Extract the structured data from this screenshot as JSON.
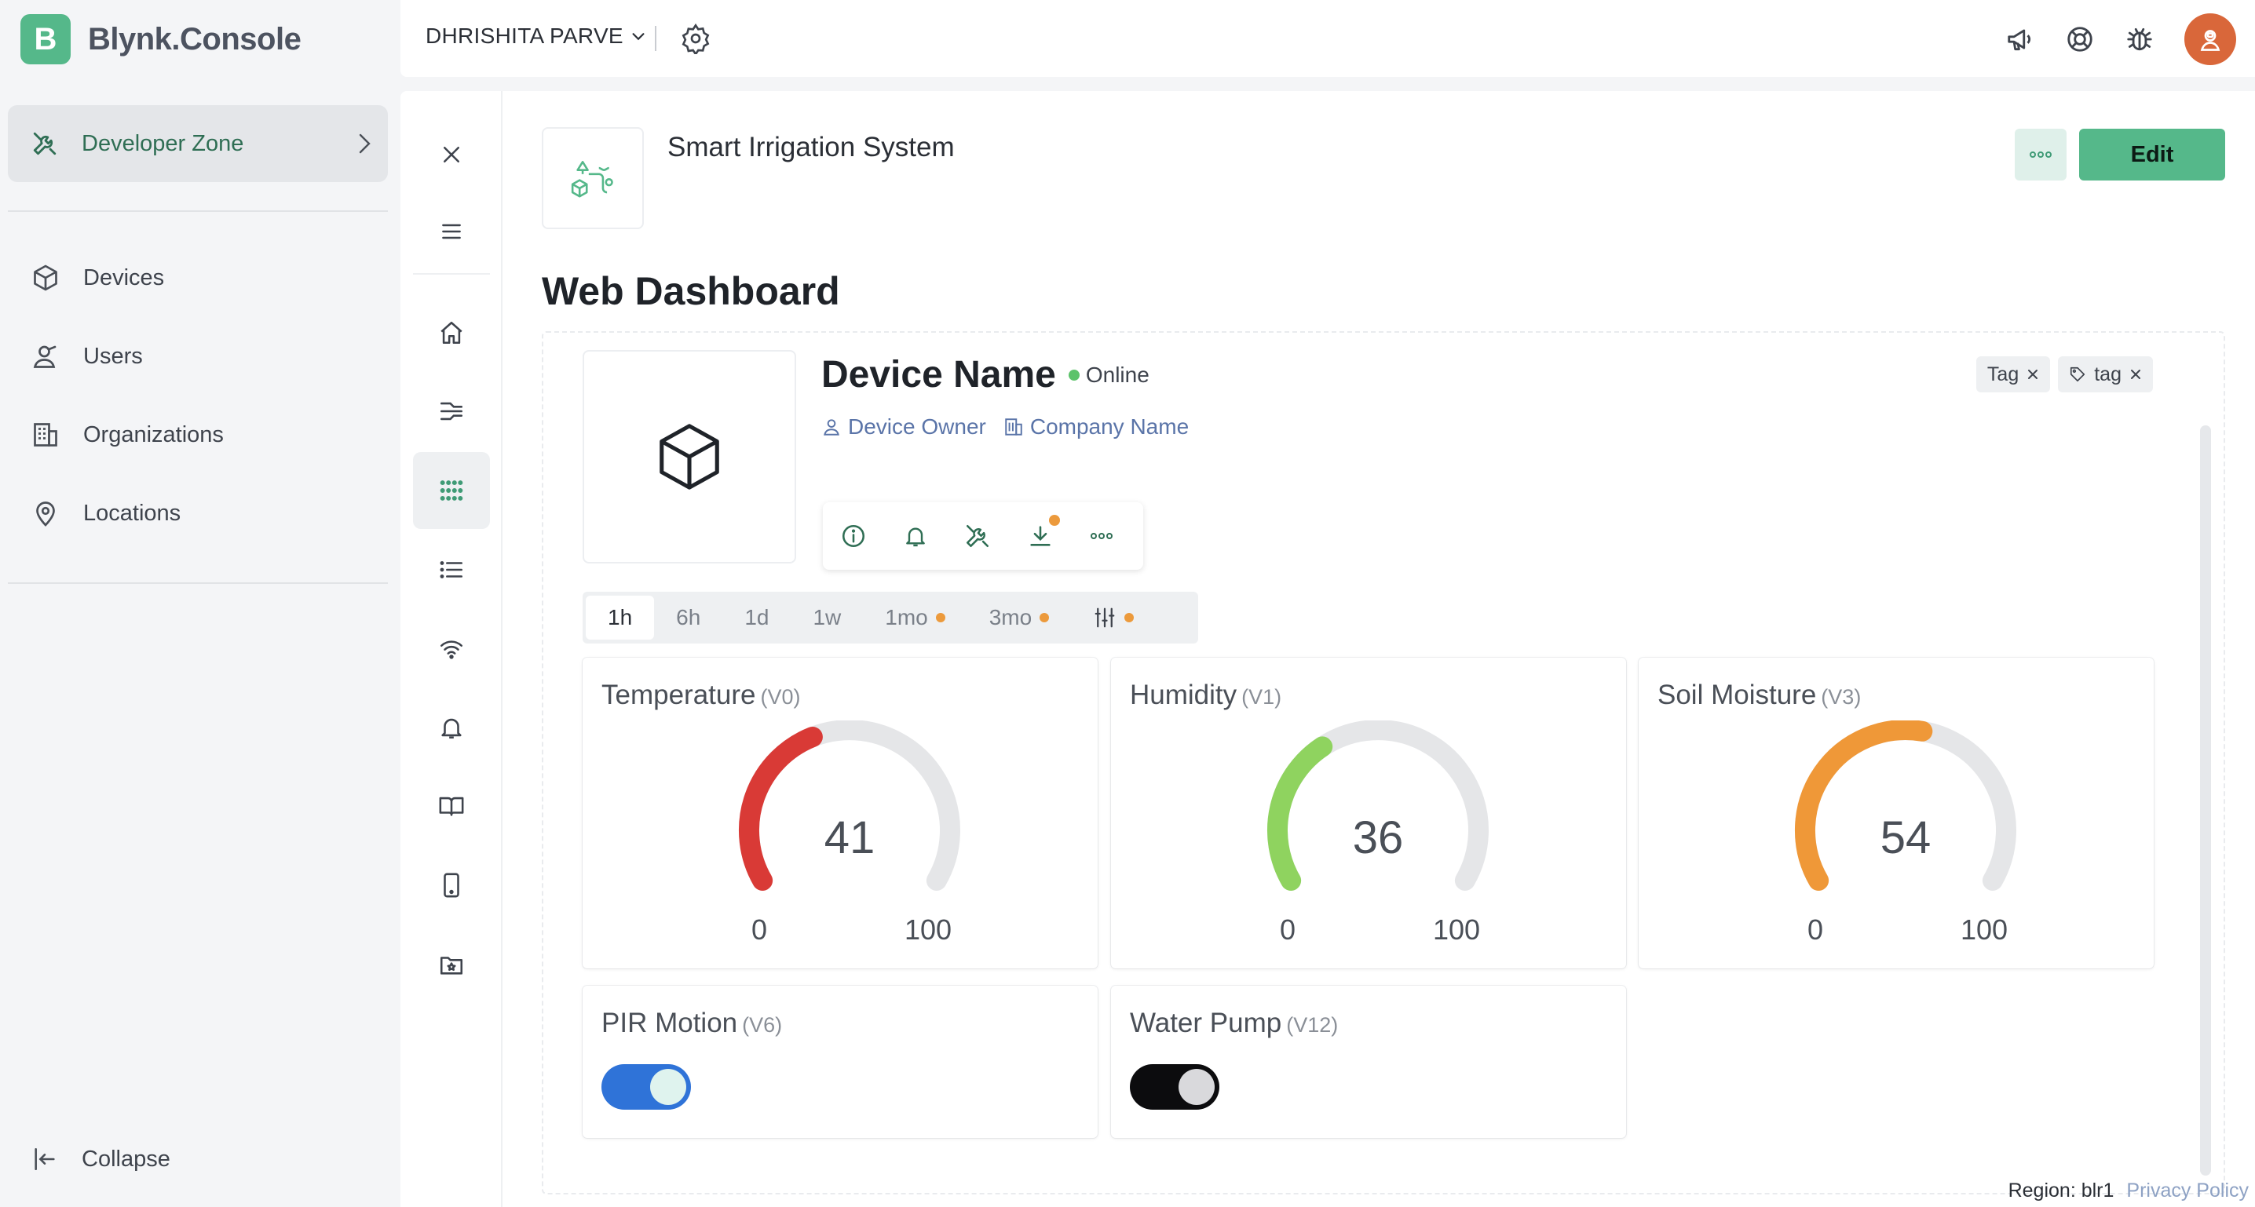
{
  "brand": {
    "logo_letter": "B",
    "name": "Blynk.Console"
  },
  "sidebar": {
    "developer_zone": {
      "label": "Developer Zone",
      "icon": "tools-icon"
    },
    "items": [
      {
        "label": "Devices",
        "icon": "cube-icon"
      },
      {
        "label": "Users",
        "icon": "user-icon"
      },
      {
        "label": "Organizations",
        "icon": "building-icon"
      },
      {
        "label": "Locations",
        "icon": "location-pin-icon"
      }
    ],
    "collapse_label": "Collapse"
  },
  "topbar": {
    "org_name": "DHRISHITA PARVE",
    "icons": [
      "settings-icon",
      "megaphone-icon",
      "lifebuoy-icon",
      "bug-icon",
      "avatar"
    ]
  },
  "iconbar": {
    "items": [
      "close-icon",
      "menu-icon",
      "home-icon",
      "datastreams-icon",
      "dashboard-grid-icon",
      "list-icon",
      "wifi-icon",
      "bell-icon",
      "book-icon",
      "mobile-icon",
      "folder-star-icon"
    ],
    "active": "dashboard-grid-icon"
  },
  "template": {
    "name": "Smart Irrigation System",
    "edit_label": "Edit"
  },
  "page_title": "Web Dashboard",
  "device": {
    "name": "Device Name",
    "status": "Online",
    "owner": "Device Owner",
    "company": "Company Name",
    "tags": [
      "Tag",
      "tag"
    ]
  },
  "time_ranges": [
    {
      "label": "1h",
      "active": true,
      "dot": false
    },
    {
      "label": "6h",
      "active": false,
      "dot": false
    },
    {
      "label": "1d",
      "active": false,
      "dot": false
    },
    {
      "label": "1w",
      "active": false,
      "dot": false
    },
    {
      "label": "1mo",
      "active": false,
      "dot": true
    },
    {
      "label": "3mo",
      "active": false,
      "dot": true
    }
  ],
  "widgets": {
    "temperature": {
      "title": "Temperature",
      "pin": "(V0)",
      "value": "41",
      "min": "0",
      "max": "100",
      "fraction": 0.41,
      "color": "#d93a36"
    },
    "humidity": {
      "title": "Humidity",
      "pin": "(V1)",
      "value": "36",
      "min": "0",
      "max": "100",
      "fraction": 0.36,
      "color": "#8fd35f"
    },
    "soil": {
      "title": "Soil Moisture",
      "pin": "(V3)",
      "value": "54",
      "min": "0",
      "max": "100",
      "fraction": 0.54,
      "color": "#ef9838"
    },
    "pir": {
      "title": "PIR Motion",
      "pin": "(V6)",
      "on": true,
      "color": "#2f73d8"
    },
    "pump": {
      "title": "Water Pump",
      "pin": "(V12)",
      "on": false,
      "color": "#0c0c0e"
    }
  },
  "footer": {
    "region": "Region: blr1",
    "privacy": "Privacy Policy"
  },
  "colors": {
    "accent": "#55b88a",
    "link": "#5a74a8",
    "online": "#5cc36a",
    "warning_dot": "#ec9a3c",
    "gauge_track": "#e5e6e8"
  }
}
